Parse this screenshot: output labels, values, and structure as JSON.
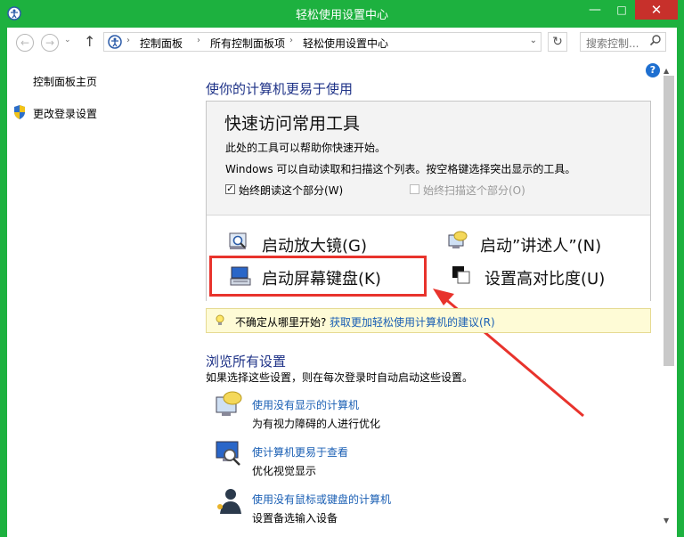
{
  "window": {
    "title": "轻松使用设置中心",
    "min": "—",
    "max": "□",
    "close": "✕"
  },
  "nav": {
    "back": "←",
    "forward": "→",
    "recent": "⌄",
    "up": "↑",
    "breadcrumbs": [
      "控制面板",
      "所有控制面板项",
      "轻松使用设置中心"
    ],
    "sep": "›",
    "dropdown": "⌄",
    "refresh": "↻",
    "search_placeholder": "搜索控制..."
  },
  "left_pane": {
    "home": "控制面板主页",
    "login": "更改登录设置"
  },
  "help": "?",
  "main": {
    "heading": "使你的计算机更易于使用",
    "quick_access": {
      "title": "快速访问常用工具",
      "line1": "此处的工具可以帮助你快速开始。",
      "line2": "Windows 可以自动读取和扫描这个列表。按空格键选择突出显示的工具。",
      "checkbox_read": {
        "label": "始终朗读这个部分(W)",
        "checked": true,
        "mark": "✓"
      },
      "checkbox_scan": {
        "label": "始终扫描这个部分(O)",
        "checked": false
      }
    },
    "tools": [
      {
        "label": "启动放大镜(G)",
        "icon": "magnifier-icon"
      },
      {
        "label": "启动”讲述人”(N)",
        "icon": "narrator-icon"
      },
      {
        "label": "启动屏幕键盘(K)",
        "icon": "onscreen-keyboard-icon"
      },
      {
        "label": "设置高对比度(U)",
        "icon": "high-contrast-icon"
      }
    ],
    "tip": {
      "text": "不确定从哪里开始?",
      "link": "获取更加轻松使用计算机的建议(R)"
    },
    "browse": {
      "heading": "浏览所有设置",
      "desc": "如果选择这些设置，则在每次登录时自动启动这些设置。",
      "items": [
        {
          "link": "使用没有显示的计算机",
          "desc": "为有视力障碍的人进行优化",
          "icon": "narrator-speech-icon"
        },
        {
          "link": "使计算机更易于查看",
          "desc": "优化视觉显示",
          "icon": "monitor-magnifier-icon"
        },
        {
          "link": "使用没有鼠标或键盘的计算机",
          "desc": "设置备选输入设备",
          "icon": "person-input-icon"
        }
      ]
    }
  },
  "colors": {
    "window_frame": "#1db13f",
    "link": "#1a5fb4",
    "heading": "#1e3287",
    "annotation": "#e8332c"
  }
}
